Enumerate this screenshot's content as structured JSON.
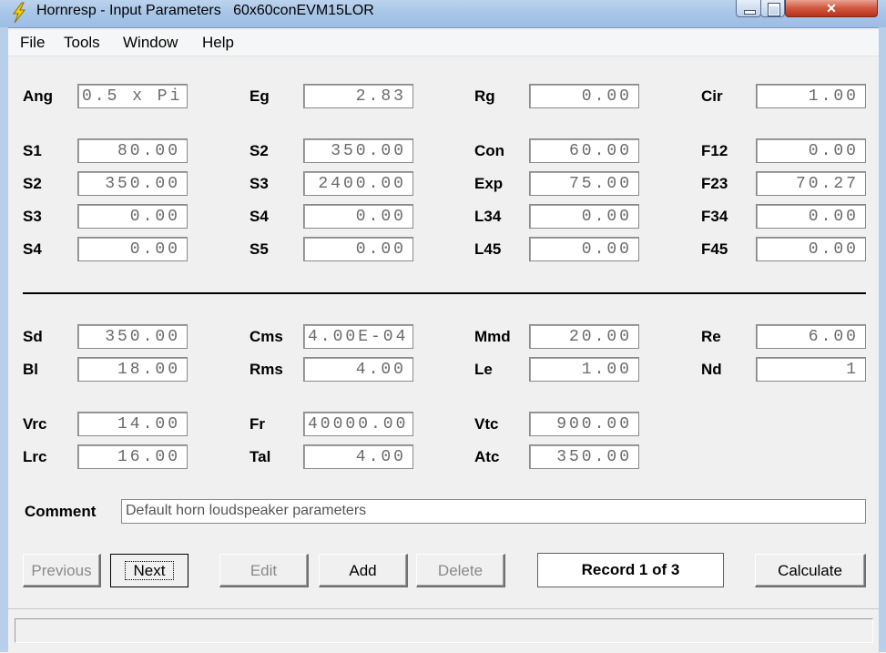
{
  "window": {
    "title": "Hornresp - Input Parameters   60x60conEVM15LOR"
  },
  "menu": [
    "File",
    "Tools",
    "Window",
    "Help"
  ],
  "params": {
    "ang": {
      "label": "Ang",
      "value": "0.5 x Pi"
    },
    "eg": {
      "label": "Eg",
      "value": "2.83"
    },
    "rg": {
      "label": "Rg",
      "value": "0.00"
    },
    "cir": {
      "label": "Cir",
      "value": "1.00"
    },
    "s1a": {
      "label": "S1",
      "value": "80.00"
    },
    "s2a": {
      "label": "S2",
      "value": "350.00"
    },
    "s3a": {
      "label": "S3",
      "value": "0.00"
    },
    "s4a": {
      "label": "S4",
      "value": "0.00"
    },
    "s2b": {
      "label": "S2",
      "value": "350.00"
    },
    "s3b": {
      "label": "S3",
      "value": "2400.00"
    },
    "s4b": {
      "label": "S4",
      "value": "0.00"
    },
    "s5b": {
      "label": "S5",
      "value": "0.00"
    },
    "con": {
      "label": "Con",
      "value": "60.00"
    },
    "exp": {
      "label": "Exp",
      "value": "75.00"
    },
    "l34": {
      "label": "L34",
      "value": "0.00"
    },
    "l45": {
      "label": "L45",
      "value": "0.00"
    },
    "f12": {
      "label": "F12",
      "value": "0.00"
    },
    "f23": {
      "label": "F23",
      "value": "70.27"
    },
    "f34": {
      "label": "F34",
      "value": "0.00"
    },
    "f45": {
      "label": "F45",
      "value": "0.00"
    },
    "sd": {
      "label": "Sd",
      "value": "350.00"
    },
    "bl": {
      "label": "Bl",
      "value": "18.00"
    },
    "cms": {
      "label": "Cms",
      "value": "4.00E-04"
    },
    "rms": {
      "label": "Rms",
      "value": "4.00"
    },
    "mmd": {
      "label": "Mmd",
      "value": "20.00"
    },
    "le": {
      "label": "Le",
      "value": "1.00"
    },
    "re": {
      "label": "Re",
      "value": "6.00"
    },
    "nd": {
      "label": "Nd",
      "value": "1"
    },
    "vrc": {
      "label": "Vrc",
      "value": "14.00"
    },
    "lrc": {
      "label": "Lrc",
      "value": "16.00"
    },
    "fr": {
      "label": "Fr",
      "value": "40000.00"
    },
    "tal": {
      "label": "Tal",
      "value": "4.00"
    },
    "vtc": {
      "label": "Vtc",
      "value": "900.00"
    },
    "atc": {
      "label": "Atc",
      "value": "350.00"
    }
  },
  "comment": {
    "label": "Comment",
    "value": "Default horn loudspeaker parameters"
  },
  "buttons": {
    "previous": "Previous",
    "next": "Next",
    "edit": "Edit",
    "add": "Add",
    "delete": "Delete",
    "calculate": "Calculate"
  },
  "record": "Record 1 of 3",
  "icons": {
    "app": "lightning-bolt-icon",
    "minimize": "minimize-icon",
    "maximize": "maximize-icon",
    "close": "close-icon"
  },
  "colors": {
    "titlebar": "#a9c6e8",
    "close_button": "#c8432a",
    "field_text": "#6a6a6a"
  }
}
